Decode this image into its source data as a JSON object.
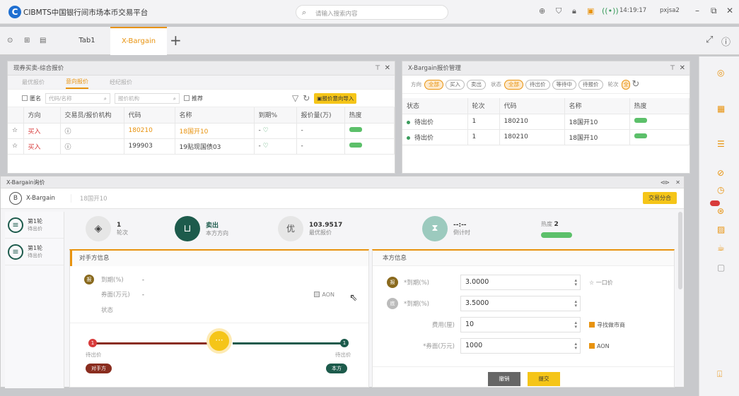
{
  "app": {
    "title": "CIBMTS中国银行间市场本币交易平台",
    "search_placeholder": "请输入搜索内容",
    "clock": "14:19:17",
    "user": "pxjsa2",
    "logo_letter": "C"
  },
  "tabs": {
    "tab1": "Tab1",
    "tab2": "X-Bargain",
    "add": "+"
  },
  "quote_panel": {
    "title": "现券买卖-综合报价",
    "subtabs": [
      "最优报价",
      "意向报价",
      "经纪报价"
    ],
    "filters": {
      "anon": "匿名",
      "code_placeholder": "代码/名称",
      "org_placeholder": "报价机构",
      "recommend": "推荐",
      "import_btn": "报价意向导入"
    },
    "columns": [
      "方向",
      "交易员/报价机构",
      "代码",
      "名称",
      "到期%",
      "报价量(万)",
      "热度"
    ],
    "rows": [
      {
        "dir": "买入",
        "code": "180210",
        "name": "18国开10",
        "yield": "-",
        "qty": "-"
      },
      {
        "dir": "买入",
        "code": "199903",
        "name": "19贴现国债03",
        "yield": "-",
        "qty": "-"
      }
    ]
  },
  "manage_panel": {
    "title": "X-Bargain报价管理",
    "filter_labels": {
      "dir": "方向",
      "status": "状态",
      "round": "轮次"
    },
    "dir_pills": [
      "全部",
      "买入",
      "卖出"
    ],
    "status_pills": [
      "全部",
      "待出价",
      "等待中",
      "待报价"
    ],
    "columns": [
      "状态",
      "轮次",
      "代码",
      "名称",
      "热度"
    ],
    "rows": [
      {
        "status": "待出价",
        "round": "1",
        "code": "180210",
        "name": "18国开10"
      },
      {
        "status": "待出价",
        "round": "1",
        "code": "180210",
        "name": "18国开10"
      }
    ]
  },
  "bargain": {
    "window_title": "X-Bargain询价",
    "header_name": "X-Bargain",
    "bond": "18国开10",
    "add_btn": "交易分合",
    "rounds": [
      {
        "label": "第1轮",
        "sub": "待出价"
      },
      {
        "label": "第1轮",
        "sub": "待出价"
      }
    ],
    "stats": [
      {
        "value": "1",
        "label": "轮次"
      },
      {
        "value": "卖出",
        "label": "本方方向"
      },
      {
        "value": "103.9517",
        "label": "最优报价",
        "icon": "优"
      },
      {
        "value": "--:--",
        "label": "倒计时"
      }
    ],
    "heat_label": "热度",
    "heat_value": "2",
    "counterparty": {
      "title": "对手方信息",
      "yield_label": "到期(%)",
      "yield": "-",
      "amount_label": "券面(万元)",
      "amount": "-",
      "aon": "AON",
      "status_label": "状态"
    },
    "timeline": {
      "left": "待出价",
      "right": "待出价",
      "left_tag": "对手方",
      "right_tag": "本方",
      "mid": "···"
    },
    "mine": {
      "title": "本方信息",
      "rows": [
        {
          "label": "*到期(%)",
          "value": "3.0000",
          "badge": "报"
        },
        {
          "label": "*到期(%)",
          "value": "3.5000",
          "badge": "底"
        },
        {
          "label": "费用(厘)",
          "value": "10"
        },
        {
          "label": "*券面(万元)",
          "value": "1000"
        }
      ],
      "one_price": "一口价",
      "help_market": "寻找做市商",
      "aon": "AON",
      "btn_grey": "撤销",
      "btn_orange": "提交"
    }
  },
  "colors": {
    "accent": "#e8930f",
    "green": "#1d5b4c",
    "buy": "#d83b3b"
  }
}
